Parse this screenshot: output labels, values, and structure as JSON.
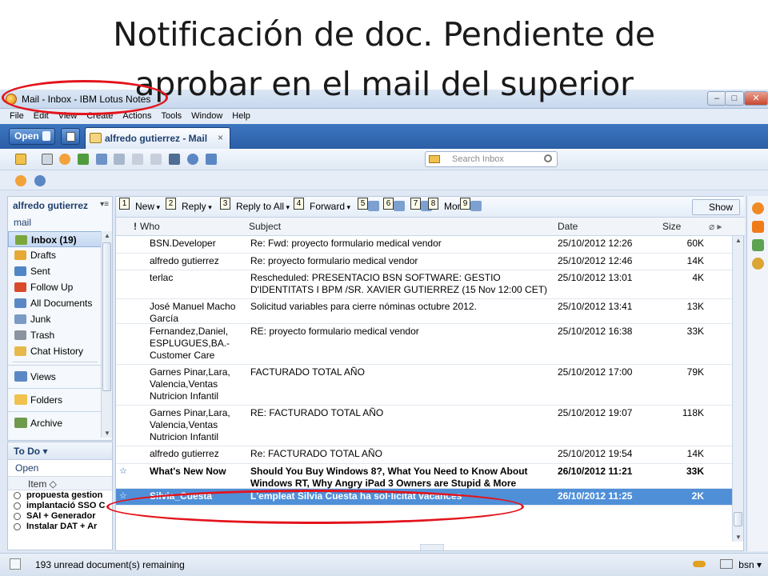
{
  "slide": {
    "title_line1": "Notificación de doc. Pendiente de",
    "title_line2": "aprobar en el mail del superior"
  },
  "window": {
    "title": "Mail - Inbox - IBM Lotus Notes",
    "controls": {
      "minimize": "–",
      "maximize": "□",
      "close": "✕"
    }
  },
  "menu": [
    "File",
    "Edit",
    "View",
    "Create",
    "Actions",
    "Tools",
    "Window",
    "Help"
  ],
  "tabbar": {
    "open_label": "Open",
    "tab_label": "alfredo gutierrez - Mail",
    "tab_close": "×"
  },
  "search": {
    "placeholder": "Search Inbox"
  },
  "sidebar": {
    "owner": "alfredo gutierrez",
    "owner_menu": "▾≡",
    "section": "mail",
    "items": [
      {
        "label": "Inbox (19)",
        "icon": "inbox-icon",
        "color": "#7aa63c"
      },
      {
        "label": "Drafts",
        "icon": "drafts-icon",
        "color": "#e6a935"
      },
      {
        "label": "Sent",
        "icon": "sent-icon",
        "color": "#4f86c6"
      },
      {
        "label": "Follow Up",
        "icon": "flag-icon",
        "color": "#d94b2b"
      },
      {
        "label": "All Documents",
        "icon": "all-documents-icon",
        "color": "#5b87c5"
      },
      {
        "label": "Junk",
        "icon": "junk-icon",
        "color": "#7b9bc4"
      },
      {
        "label": "Trash",
        "icon": "trash-icon",
        "color": "#8b949f"
      },
      {
        "label": "Chat History",
        "icon": "chat-icon",
        "color": "#e6b94a"
      }
    ],
    "groups": [
      {
        "label": "Views",
        "icon": "views-icon",
        "color": "#5b87c5"
      },
      {
        "label": "Folders",
        "icon": "folders-icon",
        "color": "#f0c14d"
      },
      {
        "label": "Archive",
        "icon": "archive-icon",
        "color": "#6f9a4c"
      }
    ]
  },
  "todo": {
    "header": "To Do",
    "sub": "Open",
    "column": "Item ◇",
    "items": [
      "propuesta gestion",
      "implantació SSO C",
      "SAI + Generador",
      "Instalar DAT + Ar"
    ]
  },
  "actions": [
    {
      "num": "1",
      "label": "New"
    },
    {
      "num": "2",
      "label": "Reply"
    },
    {
      "num": "3",
      "label": "Reply to All"
    },
    {
      "num": "4",
      "label": "Forward"
    },
    {
      "num": "5",
      "label": ""
    },
    {
      "num": "6",
      "label": ""
    },
    {
      "num": "7",
      "label": ""
    },
    {
      "num": "8",
      "label": "More"
    },
    {
      "num": "9",
      "label": ""
    }
  ],
  "show_label": "Show",
  "columns": {
    "who": "Who",
    "subject": "Subject",
    "date": "Date",
    "size": "Size"
  },
  "emails": [
    {
      "who": "BSN.Developer",
      "subject": "Re: Fwd: proyecto formulario medical vendor",
      "date": "25/10/2012 12:26",
      "size": "60K",
      "bold": false,
      "selected": false
    },
    {
      "who": "alfredo gutierrez",
      "subject": "Re: proyecto formulario medical vendor",
      "date": "25/10/2012 12:46",
      "size": "14K",
      "bold": false,
      "selected": false
    },
    {
      "who": "terlac",
      "subject": "Rescheduled: PRESENTACIO BSN SOFTWARE: GESTIO D'IDENTITATS I BPM /SR. XAVIER GUTIERREZ (15 Nov 12:00 CET)",
      "date": "25/10/2012 13:01",
      "size": "4K",
      "bold": false,
      "selected": false
    },
    {
      "who": "José Manuel Macho García",
      "subject": "Solicitud variables para cierre nóminas octubre 2012.",
      "date": "25/10/2012 13:41",
      "size": "13K",
      "bold": false,
      "selected": false
    },
    {
      "who": "Fernandez,Daniel, ESPLUGUES,BA.-Customer Care",
      "subject": "RE: proyecto formulario medical vendor",
      "date": "25/10/2012 16:38",
      "size": "33K",
      "bold": false,
      "selected": false
    },
    {
      "who": "Garnes Pinar,Lara, Valencia,Ventas Nutricion Infantil",
      "subject": "FACTURADO TOTAL AÑO",
      "date": "25/10/2012 17:00",
      "size": "79K",
      "bold": false,
      "selected": false
    },
    {
      "who": "Garnes Pinar,Lara, Valencia,Ventas Nutricion Infantil",
      "subject": "RE: FACTURADO TOTAL AÑO",
      "date": "25/10/2012 19:07",
      "size": "118K",
      "bold": false,
      "selected": false
    },
    {
      "who": "alfredo gutierrez",
      "subject": "Re: FACTURADO TOTAL AÑO",
      "date": "25/10/2012 19:54",
      "size": "14K",
      "bold": false,
      "selected": false
    },
    {
      "who": "What's New Now",
      "subject": "Should You Buy Windows 8?, What You Need to Know About Windows RT, Why Angry iPad 3 Owners are Stupid & More",
      "date": "26/10/2012 11:21",
      "size": "33K",
      "bold": true,
      "selected": false
    },
    {
      "who": "Silvia_Cuesta",
      "subject": "L'empleat Silvia Cuesta ha sol·licitat vacances",
      "date": "26/10/2012 11:25",
      "size": "2K",
      "bold": true,
      "selected": true
    }
  ],
  "status": {
    "text": "193 unread document(s) remaining",
    "user": "bsn ▾"
  },
  "colors": {
    "highlight_ring": "#e3141c",
    "selection": "#4f8fd8",
    "tab_bar": "#2b5ea6"
  }
}
